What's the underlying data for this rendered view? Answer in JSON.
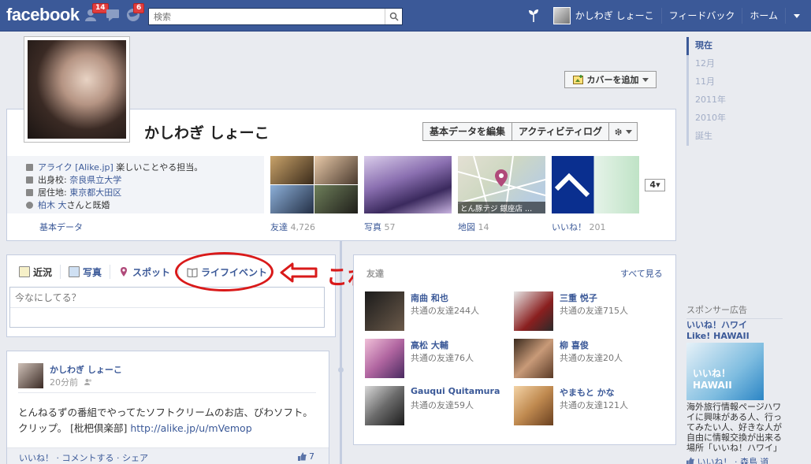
{
  "topbar": {
    "logo": "facebook",
    "friend_requests_badge": "14",
    "notifications_badge": "6",
    "search_placeholder": "検索",
    "user_name": "かしわぎ しょーこ",
    "feedback": "フィードバック",
    "home": "ホーム"
  },
  "profile": {
    "name": "かしわぎ しょーこ",
    "cover_button": "カバーを追加",
    "edit_button": "基本データを編集",
    "activity_button": "アクティビティログ",
    "info": [
      {
        "prefix": "",
        "link": "アライク [Alike.jp]",
        "suffix": " 楽しいことやる担当。"
      },
      {
        "prefix": "出身校: ",
        "link": "奈良県立大学",
        "suffix": ""
      },
      {
        "prefix": "居住地: ",
        "link": "東京都大田区",
        "suffix": ""
      },
      {
        "prefix": "",
        "link": "柏木 大",
        "suffix": "さんと既婚"
      }
    ],
    "basic_data_label": "基本データ",
    "tiles": [
      {
        "label": "友達",
        "count": "4,726"
      },
      {
        "label": "写真",
        "count": "57"
      },
      {
        "label": "地図",
        "count": "14"
      },
      {
        "label": "いいね！",
        "count": "201"
      }
    ],
    "map_overlay_text": "とん豚テジ 銀座店 ...",
    "more_button": "4"
  },
  "timeline_nav": [
    "現在",
    "12月",
    "11月",
    "2011年",
    "2010年",
    "誕生"
  ],
  "composer": {
    "tabs": [
      "近況",
      "写真",
      "スポット",
      "ライフイベント"
    ],
    "placeholder": "今なにしてる？"
  },
  "annotation": {
    "text": "これ。"
  },
  "friends": {
    "title": "友達",
    "see_all": "すべて見る",
    "items": [
      {
        "name": "南曲 和也",
        "mutual": "共通の友達244人"
      },
      {
        "name": "三重 悦子",
        "mutual": "共通の友達715人"
      },
      {
        "name": "高松 大輔",
        "mutual": "共通の友達76人"
      },
      {
        "name": "柳 喜俊",
        "mutual": "共通の友達20人"
      },
      {
        "name": "Gauqui Quitamura",
        "mutual": "共通の友達59人"
      },
      {
        "name": "やまもと かな",
        "mutual": "共通の友達121人"
      }
    ]
  },
  "post": {
    "author": "かしわぎ しょーこ",
    "time": "20分前",
    "text": "とんねるずの番組でやってたソフトクリームのお店、びわソフト。クリップ。 [枇杷倶楽部] ",
    "link": "http://alike.jp/u/mVemop",
    "actions": "いいね！ · コメントする · シェア",
    "likes": "7"
  },
  "sponsor": {
    "header": "スポンサー広告",
    "title_line1": "いいね！ハワイ",
    "title_line2": "Like! HAWAII",
    "image_text": "いいね！HAWAII",
    "body": "海外旅行情報ページハワイに興味がある人、行ってみたい人、好きな人が自由に情報交換が出来る場所「いいね！ハワイ」",
    "like_line": "いいね！ · 森島 道"
  },
  "colors": {
    "brand": "#3b5998",
    "annotation_red": "#d91a1a",
    "badge_red": "#e23d3d"
  }
}
